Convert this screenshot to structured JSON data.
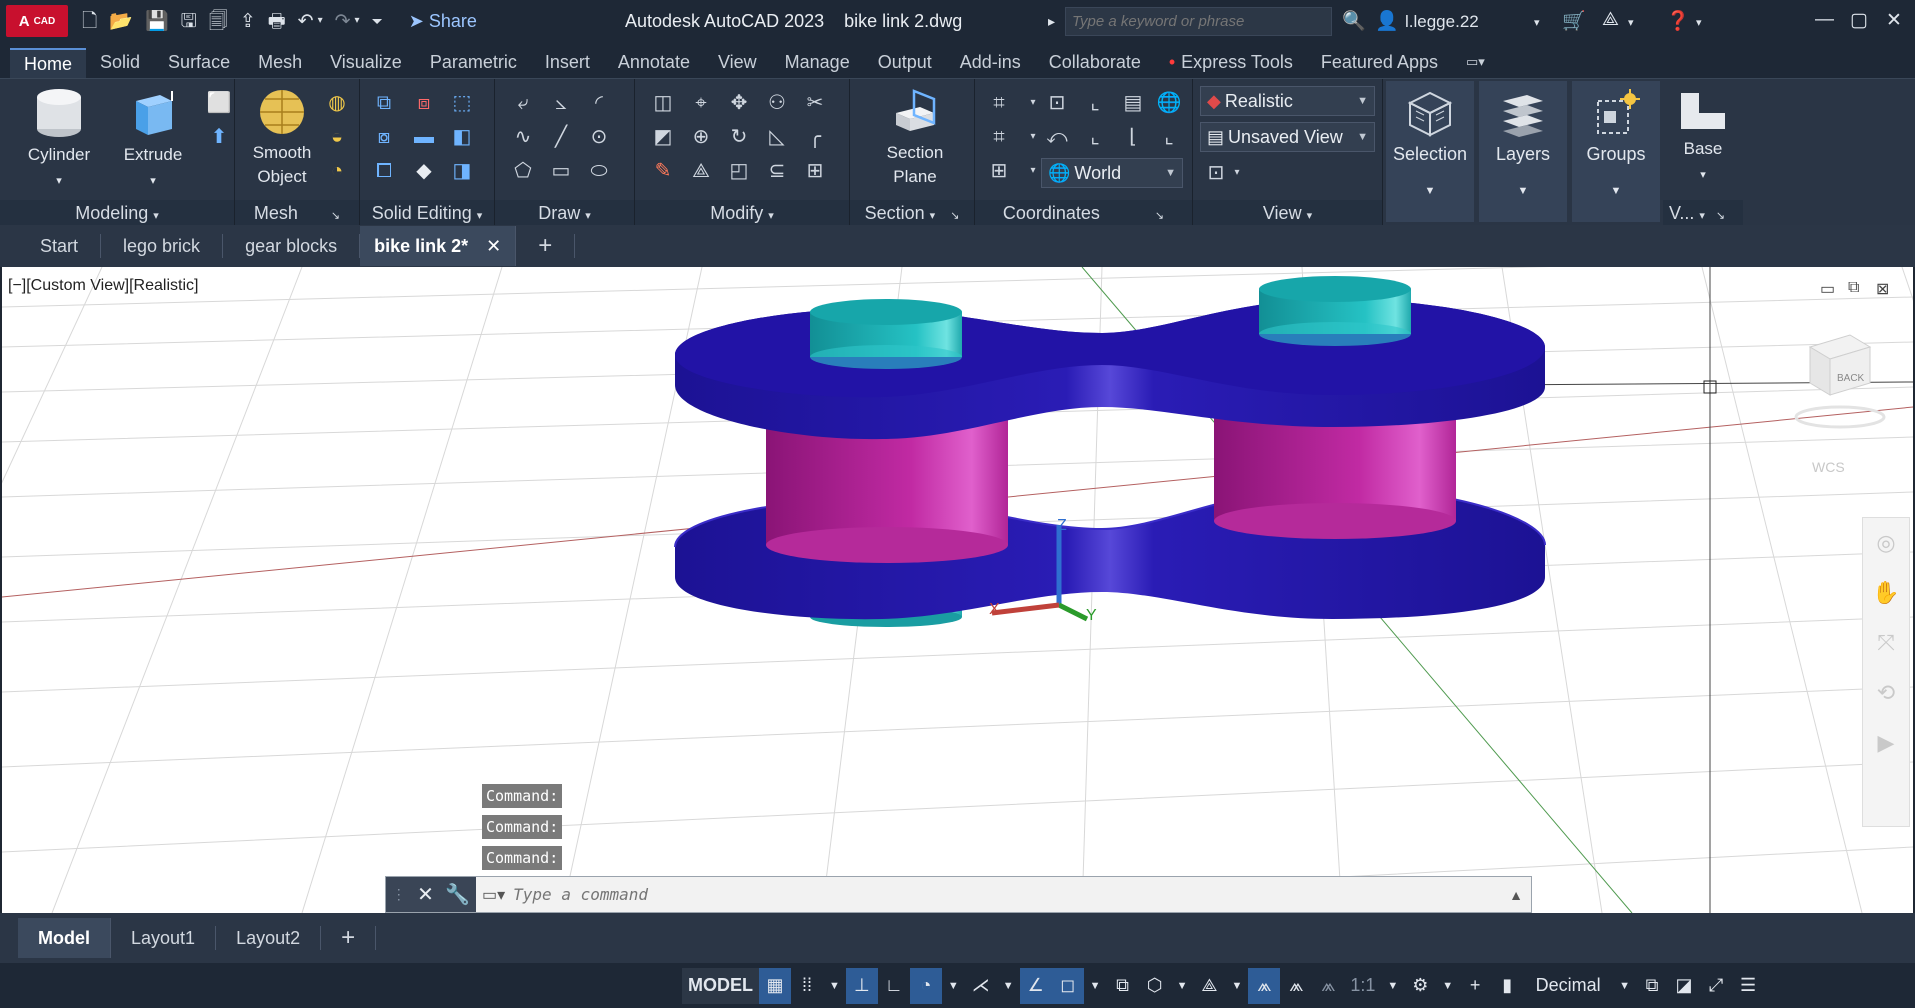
{
  "window": {
    "app_title": "Autodesk AutoCAD 2023",
    "file_name": "bike link 2.dwg"
  },
  "logo": {
    "letter": "A",
    "text": "CAD"
  },
  "quick_access": {
    "share_label": "Share"
  },
  "search": {
    "placeholder": "Type a keyword or phrase"
  },
  "user": {
    "name": "l.legge.22"
  },
  "ribbon_tabs": [
    "Home",
    "Solid",
    "Surface",
    "Mesh",
    "Visualize",
    "Parametric",
    "Insert",
    "Annotate",
    "View",
    "Manage",
    "Output",
    "Add-ins",
    "Collaborate",
    "Express Tools",
    "Featured Apps"
  ],
  "panels": {
    "modeling": "Modeling",
    "mesh": "Mesh",
    "solid_editing": "Solid Editing",
    "draw": "Draw",
    "modify": "Modify",
    "section": "Section",
    "coordinates": "Coordinates",
    "view": "View",
    "view_short": "V..."
  },
  "buttons": {
    "cylinder": "Cylinder",
    "extrude": "Extrude",
    "smooth_object_1": "Smooth",
    "smooth_object_2": "Object",
    "section_plane_1": "Section",
    "section_plane_2": "Plane",
    "selection": "Selection",
    "layers": "Layers",
    "groups": "Groups",
    "base": "Base"
  },
  "combos": {
    "visual_style": "Realistic",
    "named_view": "Unsaved View",
    "ucs": "World"
  },
  "doc_tabs": [
    "Start",
    "lego brick",
    "gear blocks",
    "bike link 2*"
  ],
  "viewport": {
    "label": "[−][Custom View][Realistic]",
    "viewcube_label": "BACK",
    "wcs_label": "WCS",
    "axis_z": "Z",
    "axis_y": "Y",
    "axis_x": "X"
  },
  "command": {
    "history": [
      "Command:",
      "Command:",
      "Command:"
    ],
    "placeholder": "Type a command"
  },
  "layout_tabs": [
    "Model",
    "Layout1",
    "Layout2"
  ],
  "status": {
    "model": "MODEL",
    "scale": "1:1",
    "units": "Decimal"
  },
  "colors": {
    "link_plate": "#2418a8",
    "pin_cap": "#1fb3b3",
    "roller": "#c0289f",
    "ribbon_bg": "#2a3545",
    "accent": "#2e5c96"
  }
}
